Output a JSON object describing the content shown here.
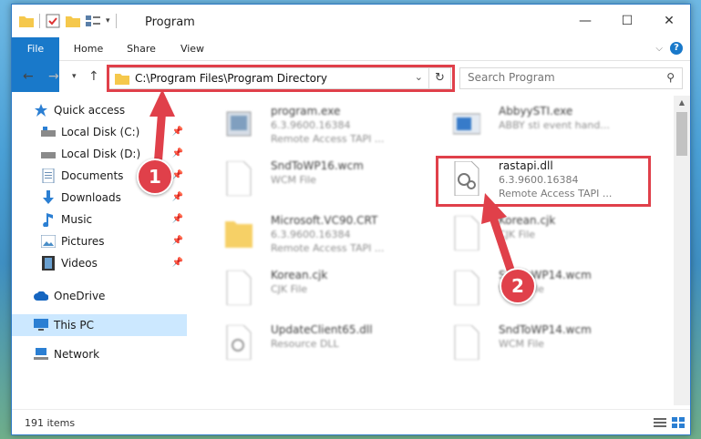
{
  "window": {
    "title": "Program",
    "controls": {
      "minimize": "—",
      "maximize": "☐",
      "close": "✕"
    }
  },
  "ribbon": {
    "tabs": [
      "File",
      "Home",
      "Share",
      "View"
    ]
  },
  "address": {
    "path": "C:\\Program Files\\Program Directory",
    "search_placeholder": "Search Program"
  },
  "sidebar": {
    "items": [
      {
        "label": "Quick access",
        "icon": "star-icon",
        "pinned": false
      },
      {
        "label": "Local Disk (C:)",
        "icon": "drive-icon",
        "pinned": true
      },
      {
        "label": "Local Disk (D:)",
        "icon": "drive-icon",
        "pinned": true
      },
      {
        "label": "Documents",
        "icon": "documents-icon",
        "pinned": true
      },
      {
        "label": "Downloads",
        "icon": "downloads-icon",
        "pinned": true
      },
      {
        "label": "Music",
        "icon": "music-icon",
        "pinned": true
      },
      {
        "label": "Pictures",
        "icon": "pictures-icon",
        "pinned": true
      },
      {
        "label": "Videos",
        "icon": "videos-icon",
        "pinned": true
      },
      {
        "label": "OneDrive",
        "icon": "cloud-icon",
        "pinned": false
      },
      {
        "label": "This PC",
        "icon": "computer-icon",
        "pinned": false
      },
      {
        "label": "Network",
        "icon": "network-icon",
        "pinned": false
      }
    ]
  },
  "files": [
    {
      "name": "program.exe",
      "line2": "6.3.9600.16384",
      "line3": "Remote Access TAPI ..."
    },
    {
      "name": "AbbyySTI.exe",
      "line2": "",
      "line3": "ABBY sti event hand..."
    },
    {
      "name": "SndToWP16.wcm",
      "line2": "WCM File",
      "line3": ""
    },
    {
      "name": "rastapi.dll",
      "line2": "6.3.9600.16384",
      "line3": "Remote Access TAPI ..."
    },
    {
      "name": "Microsoft.VC90.CRT",
      "line2": "6.3.9600.16384",
      "line3": "Remote Access TAPI ..."
    },
    {
      "name": "Korean.cjk",
      "line2": "CJK File",
      "line3": ""
    },
    {
      "name": "Korean.cjk",
      "line2": "CJK File",
      "line3": ""
    },
    {
      "name": "SndToWP14.wcm",
      "line2": "WCM File",
      "line3": ""
    },
    {
      "name": "UpdateClient65.dll",
      "line2": "Resource DLL",
      "line3": ""
    },
    {
      "name": "SndToWP14.wcm",
      "line2": "WCM File",
      "line3": ""
    }
  ],
  "status": {
    "count": "191 items"
  },
  "annotations": {
    "step1": "1",
    "step2": "2"
  },
  "colors": {
    "accent": "#1979ca",
    "highlight": "#e0404a",
    "selected": "#cce8ff"
  }
}
